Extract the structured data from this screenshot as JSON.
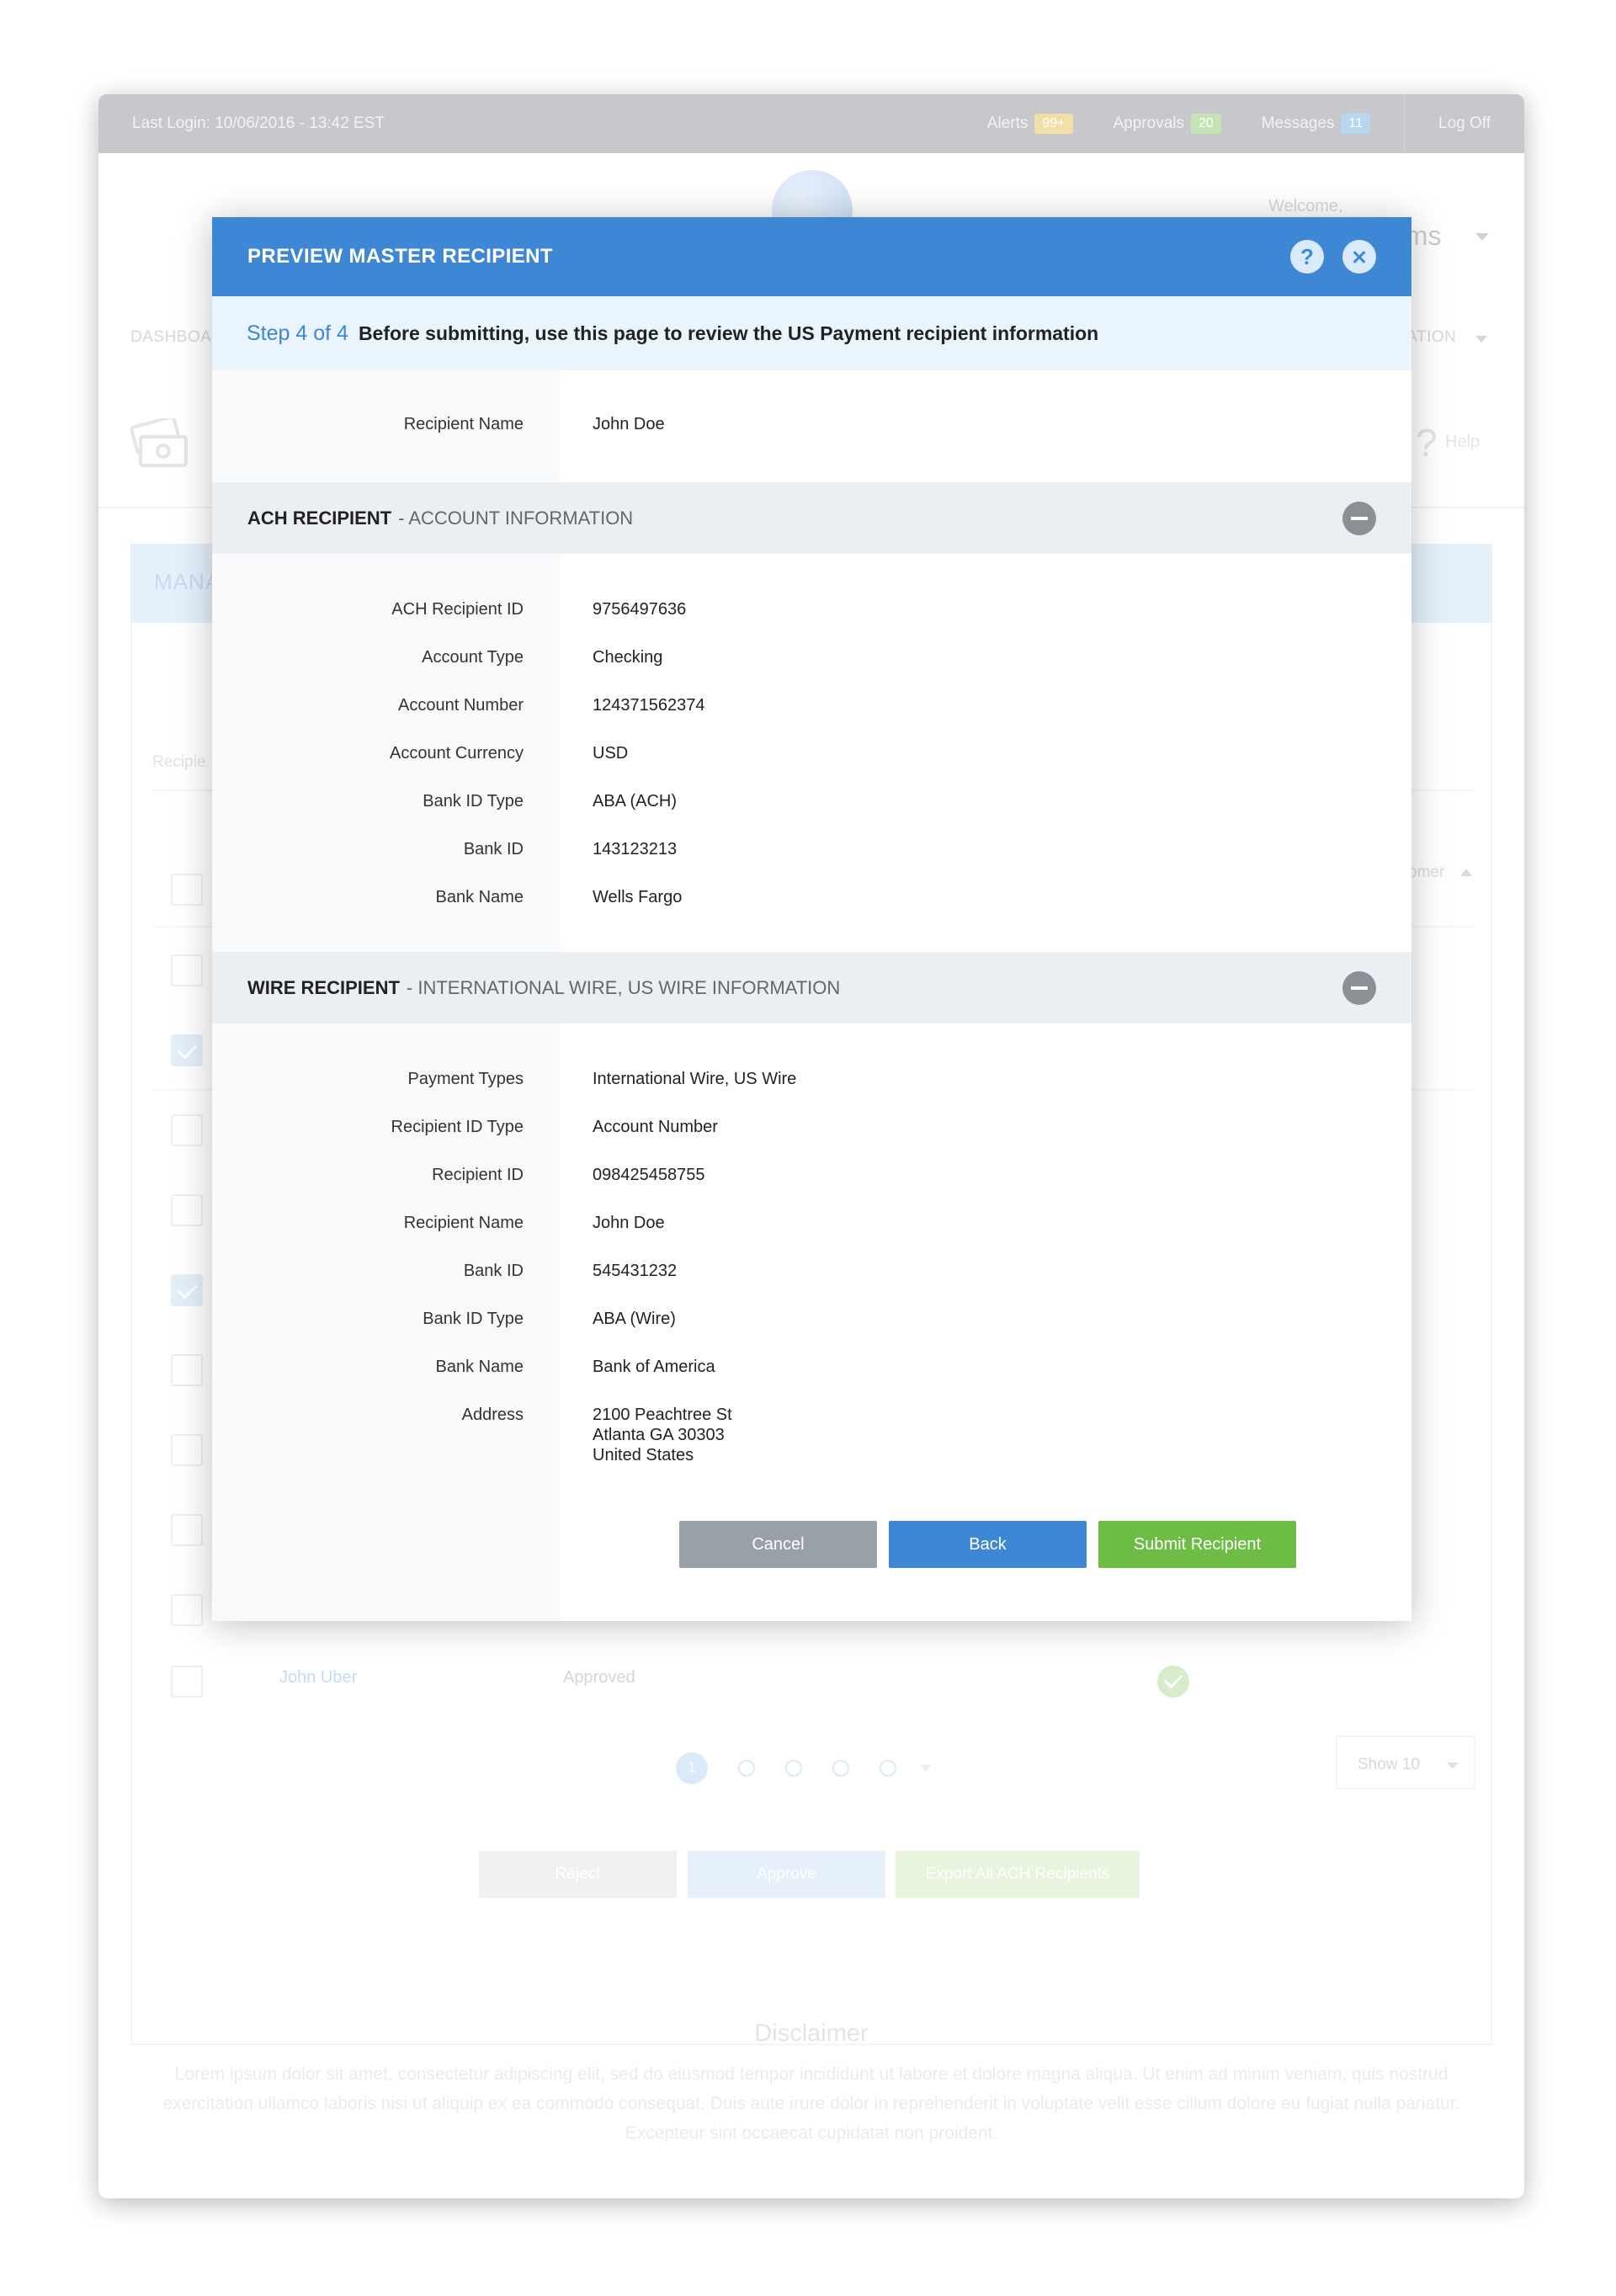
{
  "topbar": {
    "last_login": "Last Login: 10/06/2016 - 13:42 EST",
    "alerts_label": "Alerts",
    "alerts_count": "99+",
    "approvals_label": "Approvals",
    "approvals_count": "20",
    "messages_label": "Messages",
    "messages_count": "11",
    "logoff": "Log Off"
  },
  "header": {
    "welcome": "Welcome,",
    "user_name_partial": "ams"
  },
  "nav": {
    "left_partial": "DASHBOA",
    "right_partial": "RATION"
  },
  "page": {
    "help": "Help",
    "manage_partial": "MANA",
    "recipient_partial": "Recipie",
    "grid_header_partial": "omer"
  },
  "table": {
    "last_row_name": "John Uber",
    "last_row_status": "Approved"
  },
  "pagination": {
    "active_page": "1",
    "show": "Show 10"
  },
  "bg_buttons": {
    "reject": "Reject",
    "approve": "Approve",
    "export": "Export All ACH Recipients"
  },
  "disclaimer": {
    "title": "Disclaimer",
    "text": "Lorem ipsum dolor sit amet, consectetur adipiscing elit, sed do eiusmod tempor incididunt ut labore et dolore magna aliqua. Ut enim ad minim veniam, quis nostrud exercitation ullamco laboris nisi ut aliquip ex ea commodo consequat. Duis aute irure dolor in reprehenderit in voluptate velit esse cillum dolore eu fugiat nulla pariatur. Excepteur sint occaecat cupidatat non proident."
  },
  "modal": {
    "title": "PREVIEW MASTER RECIPIENT",
    "help_glyph": "?",
    "step_number": "Step 4 of 4",
    "step_text": "Before submitting, use this page to review the US Payment recipient information",
    "recipient_name_label": "Recipient Name",
    "recipient_name_value": "John Doe",
    "ach": {
      "title": "ACH RECIPIENT",
      "subtitle": "- ACCOUNT INFORMATION",
      "rows": [
        {
          "label": "ACH Recipient ID",
          "value": "9756497636"
        },
        {
          "label": "Account Type",
          "value": "Checking"
        },
        {
          "label": "Account Number",
          "value": "124371562374"
        },
        {
          "label": "Account Currency",
          "value": "USD"
        },
        {
          "label": "Bank ID Type",
          "value": "ABA (ACH)"
        },
        {
          "label": "Bank ID",
          "value": "143123213"
        },
        {
          "label": "Bank Name",
          "value": "Wells Fargo"
        }
      ]
    },
    "wire": {
      "title": "WIRE RECIPIENT",
      "subtitle": "- INTERNATIONAL WIRE, US WIRE INFORMATION",
      "rows": [
        {
          "label": "Payment Types",
          "value": "International Wire, US Wire"
        },
        {
          "label": "Recipient ID Type",
          "value": "Account Number"
        },
        {
          "label": "Recipient ID",
          "value": "098425458755"
        },
        {
          "label": "Recipient Name",
          "value": "John Doe"
        },
        {
          "label": "Bank ID",
          "value": "545431232"
        },
        {
          "label": "Bank ID Type",
          "value": "ABA (Wire)"
        },
        {
          "label": "Bank Name",
          "value": "Bank of America"
        },
        {
          "label": "Address",
          "value": "2100 Peachtree St\nAtlanta GA 30303\nUnited States"
        }
      ]
    },
    "buttons": {
      "cancel": "Cancel",
      "back": "Back",
      "submit": "Submit Recipient"
    }
  }
}
